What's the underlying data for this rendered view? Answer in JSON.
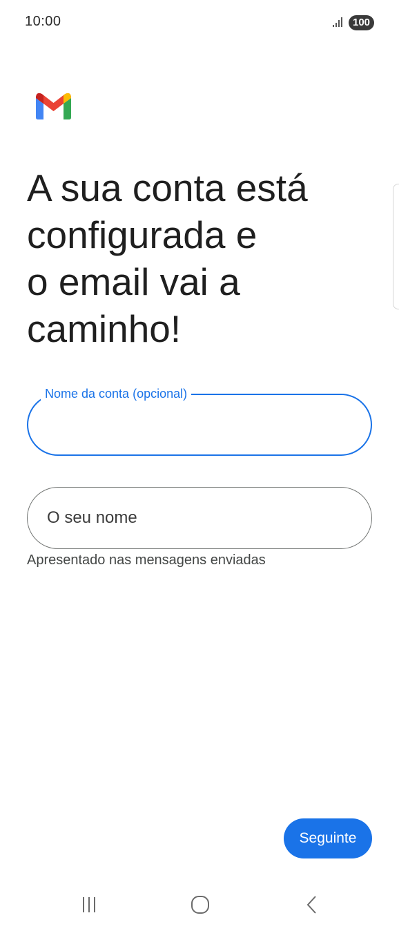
{
  "status_bar": {
    "time": "10:00",
    "battery_level": "100",
    "icons": [
      "signal-icon",
      "battery-icon"
    ]
  },
  "app": {
    "logo": "gmail-logo"
  },
  "headline": "A sua conta está\nconfigurada e\no email vai a\ncaminho!",
  "account_name_field": {
    "label": "Nome da conta (opcional)",
    "value": "",
    "state": "focused"
  },
  "your_name_field": {
    "placeholder": "O seu nome",
    "value": "",
    "helper": "Apresentado nas mensagens enviadas"
  },
  "next_button": {
    "label": "Seguinte"
  },
  "nav_bar": {
    "items": [
      "recents-icon",
      "home-icon",
      "back-icon"
    ]
  },
  "colors": {
    "accent": "#1a73e8",
    "text": "#1f1f1f",
    "outline": "#747775"
  }
}
